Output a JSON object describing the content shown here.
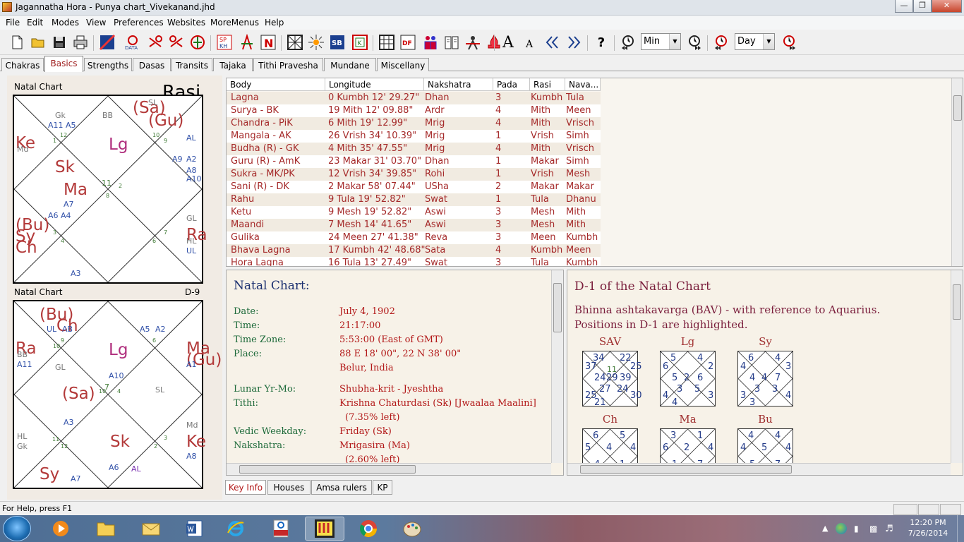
{
  "window": {
    "title": "Jagannatha Hora - Punya chart_Vivekanand.jhd"
  },
  "menu": [
    "File",
    "Edit",
    "Modes",
    "View",
    "Preferences",
    "Websites",
    "MoreMenus",
    "Help"
  ],
  "toolbar": {
    "icons": [
      "new-file-icon",
      "open-folder-icon",
      "save-icon",
      "print-icon",
      "chart-edit-icon",
      "data-icon",
      "transit-back-icon",
      "transit-fwd-icon",
      "nav-icon",
      "sp-kh-icon",
      "compass-icon",
      "n-icon",
      "grid-icon",
      "sun-icon",
      "sb-icon",
      "k-icon",
      "table-icon",
      "df-icon",
      "people-icon",
      "book-icon",
      "seeker-icon",
      "fire-icon",
      "font-large-icon",
      "font-small-icon",
      "chevron-left-icon",
      "chevron-right-icon",
      "help-icon"
    ],
    "font_large": "A",
    "font_small": "A",
    "step_unit_1": "Min",
    "step_unit_2": "Day",
    "n_label": "N",
    "sp_label": "SP\nKH",
    "sb_label": "SB",
    "df_label": "DF",
    "k_label": "K",
    "data_label": "DATA"
  },
  "tabs": [
    "Chakras",
    "Basics",
    "Strengths",
    "Dasas",
    "Transits",
    "Tajaka",
    "Tithi Pravesha",
    "Mundane",
    "Miscellany"
  ],
  "active_tab": "Basics",
  "chart1": {
    "header_left": "Natal Chart",
    "header_right": "Rasi",
    "labels": {
      "gk": "Gk",
      "a11a5": "A11 A5",
      "n12": "12",
      "bb": "BB",
      "sa": "(Sa)",
      "sl": "SL",
      "gu": "(Gu)",
      "n10": "10",
      "n9": "9",
      "al": "AL",
      "n1": "1",
      "ke": "Ke",
      "md": "Md",
      "lg": "Lg",
      "a9": "A9",
      "a2": "A2",
      "a8": "A8",
      "a10": "A10",
      "sk": "Sk",
      "n11": "11",
      "n2": "2",
      "n8": "8",
      "ma": "Ma",
      "a7": "A7",
      "a6a4": "A6 A4",
      "gl": "GL",
      "bu": "(Bu)",
      "sy": "Sy",
      "ch": "Ch",
      "n3": "3",
      "n4": "4",
      "n6": "6",
      "n7": "7",
      "ra": "Ra",
      "hl": "HL",
      "ul": "UL",
      "a3": "A3",
      "n5": "5"
    }
  },
  "chart2": {
    "header_left": "Natal Chart",
    "header_right": "D-9",
    "labels": {
      "bu": "(Bu)",
      "ch": "Ch",
      "ul": "UL",
      "ab": "AB",
      "n9": "9",
      "a5": "A5",
      "a2": "A2",
      "lg": "Lg",
      "n6": "6",
      "ra": "Ra",
      "bb": "BB",
      "a11": "A11",
      "gl": "GL",
      "n10": "10",
      "ma": "Ma",
      "gu": "(Gu)",
      "a1": "A1",
      "a10": "A10",
      "n7": "7",
      "sa": "(Sa)",
      "sl": "SL",
      "n4": "4",
      "a3": "A3",
      "hl": "HL",
      "gk": "Gk",
      "n11": "11",
      "n12": "12",
      "sk": "Sk",
      "n1": "1",
      "n2": "2",
      "n3": "3",
      "md": "Md",
      "ke": "Ke",
      "a8": "A8",
      "a9": "A9",
      "sy": "Sy",
      "a6": "A6",
      "al": "AL",
      "a7": "A7",
      "n5": "5",
      "n8": "8"
    }
  },
  "grid": {
    "headers": [
      "Body",
      "Longitude",
      "Nakshatra",
      "Pada",
      "Rasi",
      "Nava..."
    ],
    "rows": [
      [
        "Lagna",
        "0 Kumbh 12' 29.27\"",
        "Dhan",
        "3",
        "Kumbh",
        "Tula"
      ],
      [
        "Surya - BK",
        "19 Mith 12' 09.88\"",
        "Ardr",
        "4",
        "Mith",
        "Meen"
      ],
      [
        "Chandra - PiK",
        "6 Mith 19' 12.99\"",
        "Mrig",
        "4",
        "Mith",
        "Vrisch"
      ],
      [
        "Mangala - AK",
        "26 Vrish 34' 10.39\"",
        "Mrig",
        "1",
        "Vrish",
        "Simh"
      ],
      [
        "Budha (R) - GK",
        "4 Mith 35' 47.55\"",
        "Mrig",
        "4",
        "Mith",
        "Vrisch"
      ],
      [
        "Guru (R) - AmK",
        "23 Makar 31' 03.70\"",
        "Dhan",
        "1",
        "Makar",
        "Simh"
      ],
      [
        "Sukra - MK/PK",
        "12 Vrish 34' 39.85\"",
        "Rohi",
        "1",
        "Vrish",
        "Mesh"
      ],
      [
        "Sani (R) - DK",
        "2 Makar 58' 07.44\"",
        "USha",
        "2",
        "Makar",
        "Makar"
      ],
      [
        "Rahu",
        "9 Tula 19' 52.82\"",
        "Swat",
        "1",
        "Tula",
        "Dhanu"
      ],
      [
        "Ketu",
        "9 Mesh 19' 52.82\"",
        "Aswi",
        "3",
        "Mesh",
        "Mith"
      ],
      [
        "Maandi",
        "7 Mesh 14' 41.65\"",
        "Aswi",
        "3",
        "Mesh",
        "Mith"
      ],
      [
        "Gulika",
        "24 Meen 27' 41.38\"",
        "Reva",
        "3",
        "Meen",
        "Kumbh"
      ],
      [
        "Bhava Lagna",
        "17 Kumbh 42' 48.68\"",
        "Sata",
        "4",
        "Kumbh",
        "Meen"
      ],
      [
        "Hora Lagna",
        "16 Tula 13' 27.49\"",
        "Swat",
        "3",
        "Tula",
        "Kumbh"
      ]
    ]
  },
  "keyinfo": {
    "title": "Natal Chart:",
    "rows": [
      {
        "label": "Date:",
        "value": "July 4, 1902"
      },
      {
        "label": "Time:",
        "value": "21:17:00"
      },
      {
        "label": "Time Zone:",
        "value": "5:53:00 (East of GMT)"
      },
      {
        "label": "Place:",
        "value": "88 E 18' 00\", 22 N 38' 00\""
      },
      {
        "label": "",
        "value": "Belur, India"
      },
      {
        "label": "Lunar Yr-Mo:",
        "value": "Shubha-krit - Jyeshtha"
      },
      {
        "label": "Tithi:",
        "value": "Krishna Chaturdasi (Sk) [Jwaalaa Maalini]"
      },
      {
        "label": "",
        "value": "(7.35% left)"
      },
      {
        "label": "Vedic Weekday:",
        "value": "Friday (Sk)"
      },
      {
        "label": "Nakshatra:",
        "value": "Mrigasira (Ma)"
      },
      {
        "label": "",
        "value": "(2.60% left)"
      }
    ]
  },
  "bav": {
    "title": "D-1 of the Natal Chart",
    "line1": "Bhinna ashtakavarga (BAV) - with reference to Aquarius.",
    "line2": "Positions in D-1 are highlighted.",
    "charts": [
      {
        "name": "SAV",
        "center": "29",
        "inner": "11",
        "nums": [
          "34",
          "22",
          "37",
          "25",
          "24",
          "39",
          "25",
          "30",
          "27",
          "24",
          "21"
        ]
      },
      {
        "name": "Lg",
        "center": "2",
        "nums": [
          "5",
          "4",
          "6",
          "2",
          "5",
          "6",
          "4",
          "3",
          "3",
          "5",
          "4"
        ]
      },
      {
        "name": "Sy",
        "center": "4",
        "nums": [
          "6",
          "4",
          "4",
          "3",
          "4",
          "7",
          "3",
          "4",
          "3",
          "3",
          "3"
        ]
      },
      {
        "name": "Ch",
        "center": "4",
        "nums": [
          "6",
          "5",
          "5",
          "4",
          "4",
          "1",
          "6"
        ]
      },
      {
        "name": "Ma",
        "center": "2",
        "nums": [
          "3",
          "1",
          "6",
          "4",
          "1",
          "7"
        ]
      },
      {
        "name": "Bu",
        "center": "5",
        "nums": [
          "4",
          "4",
          "4",
          "4",
          "5",
          "7"
        ]
      }
    ]
  },
  "bottom_tabs": [
    "Key Info",
    "Houses",
    "Amsa rulers",
    "KP"
  ],
  "status": {
    "text": "For Help, press F1"
  },
  "taskbar": {
    "time": "12:20 PM",
    "date": "7/26/2014"
  },
  "colors": {
    "planet_red": "#b33a3a",
    "grid_text": "#a52a2a",
    "label_green": "#1e6a3a",
    "value_red": "#b21818"
  }
}
